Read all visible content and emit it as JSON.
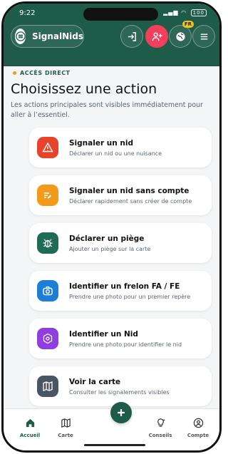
{
  "status": {
    "time": "9:22",
    "battery": "100"
  },
  "header": {
    "app_name": "SignalNids",
    "lang_badge": "FR",
    "colors": {
      "brand": "#1e5b48",
      "alert": "#f0405e",
      "badge": "#f6c416"
    },
    "icons": [
      "menu-icon",
      "login-icon",
      "add-user-icon",
      "globe-icon",
      "hamburger-icon"
    ]
  },
  "main": {
    "kicker": "ACCÈS DIRECT",
    "title": "Choisissez une action",
    "subtitle": "Les actions principales sont visibles immédiatement pour aller à l’essentiel.",
    "actions": [
      {
        "title": "Signaler un nid",
        "desc": "Déclarer un nid ou une nuisance",
        "icon": "warning-icon",
        "color": "#e8432a"
      },
      {
        "title": "Signaler un nid sans compte",
        "desc": "Déclarer rapidement sans créer de compte",
        "icon": "quick-report-icon",
        "color": "#f49a1b"
      },
      {
        "title": "Déclarer un piège",
        "desc": "Ajouter un piège sur la carte",
        "icon": "bug-icon",
        "color": "#1f6b55"
      },
      {
        "title": "Identifier un frelon FA / FE",
        "desc": "Prendre une photo pour un premier repère",
        "icon": "camera-icon",
        "color": "#1b7fd6"
      },
      {
        "title": "Identifier un Nid",
        "desc": "Prendre une photo pour identifier le nid",
        "icon": "hexagon-icon",
        "color": "#8f3ee0"
      },
      {
        "title": "Voir la carte",
        "desc": "Consulter les signalements visibles",
        "icon": "map-icon",
        "color": "#4a5563"
      }
    ]
  },
  "tabbar": {
    "items": [
      {
        "label": "Accueil",
        "icon": "home-icon",
        "active": true
      },
      {
        "label": "Carte",
        "icon": "map-icon"
      },
      {
        "label": "Conseils",
        "icon": "lightbulb-icon"
      },
      {
        "label": "Compte",
        "icon": "user-icon"
      }
    ],
    "fab_icon": "plus-icon"
  }
}
